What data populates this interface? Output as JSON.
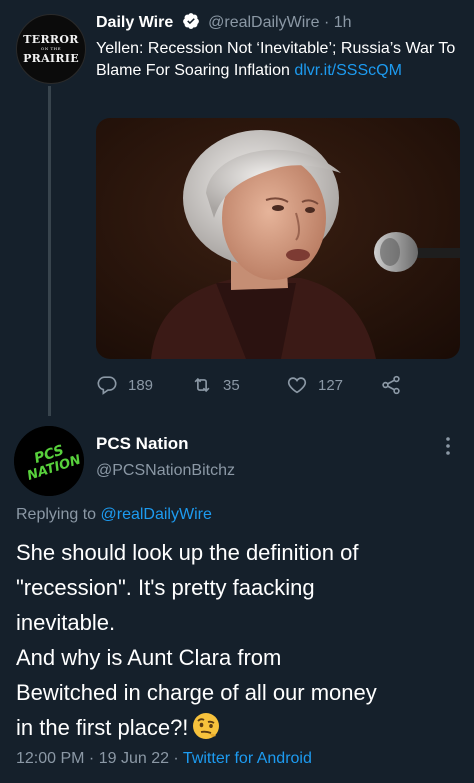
{
  "tweet1": {
    "avatar": {
      "line1": "TERROR",
      "line2": "ON THE",
      "line3": "PRAIRIE"
    },
    "author_name": "Daily Wire",
    "handle": "@realDailyWire",
    "separator": "·",
    "time": "1h",
    "text": "Yellen: Recession Not ‘Inevitable’; Russia’s War To Blame For Soaring Inflation ",
    "link": "dlvr.it/SSScQM",
    "stats": {
      "replies": "189",
      "retweets": "35",
      "likes": "127"
    },
    "icons": [
      "reply-icon",
      "retweet-icon",
      "like-icon",
      "share-icon"
    ]
  },
  "tweet2": {
    "avatar_text": {
      "line1": "PCS",
      "line2": "NATION"
    },
    "author_name": "PCS Nation",
    "handle": "@PCSNationBitchz",
    "replying_label": "Replying to ",
    "replying_to": "@realDailyWire",
    "body_lines": [
      "She should look up the definition of",
      "\"recession\". It's pretty faacking",
      "inevitable.",
      "And why is Aunt Clara from",
      "Bewitched in charge of all our money",
      "in the first place?!"
    ],
    "emoji": "face-with-raised-eyebrow",
    "time": "12:00 PM",
    "dot": " · ",
    "date": "19 Jun 22",
    "source": "Twitter for Android"
  },
  "colors": {
    "background": "#15202b",
    "muted": "#8b98a5",
    "link": "#1d9bf0",
    "avatar_green": "#58d13c"
  }
}
